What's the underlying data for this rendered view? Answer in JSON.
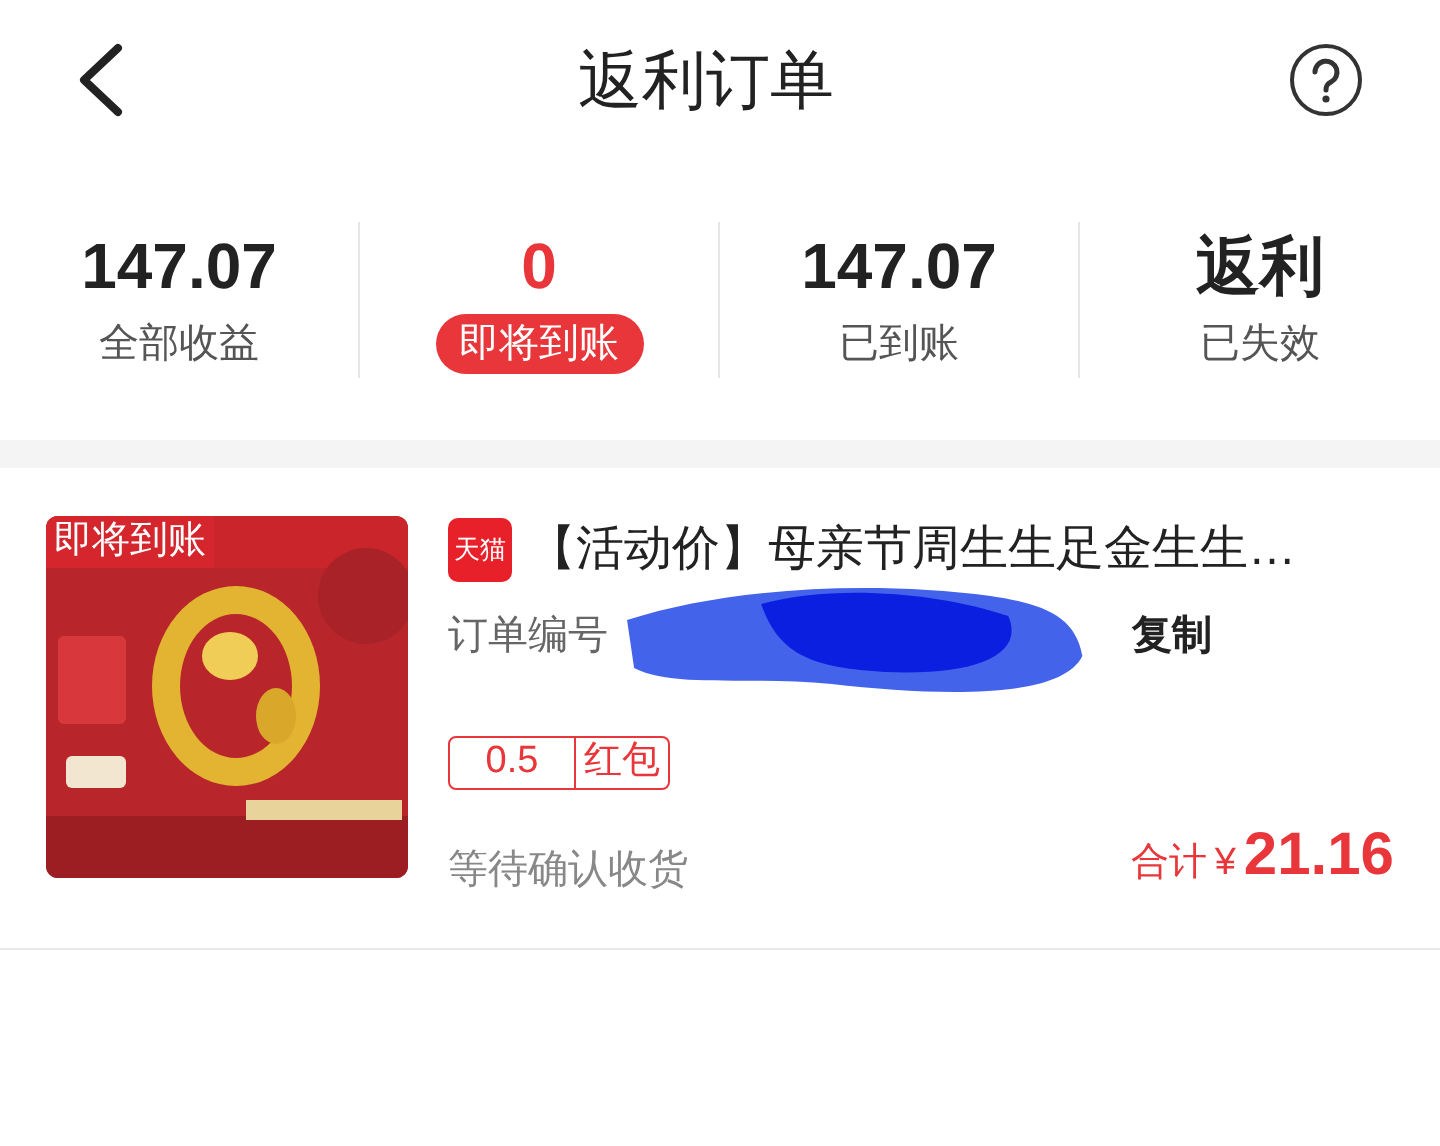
{
  "header": {
    "title": "返利订单"
  },
  "stats": [
    {
      "value": "147.07",
      "label": "全部收益",
      "selected": false
    },
    {
      "value": "0",
      "label": "即将到账",
      "selected": true
    },
    {
      "value": "147.07",
      "label": "已到账",
      "selected": false
    },
    {
      "value": "返利",
      "label": "已失效",
      "selected": false
    }
  ],
  "order": {
    "image": {
      "kind": "picture",
      "badge": "即将到账"
    },
    "shop_badge": "天猫",
    "title": "【活动价】母亲节周生生足金生生…",
    "order_number_label": "订单编号",
    "copy_button": "复制",
    "rebate_amount": "0.5",
    "rebate_type": "红包",
    "status": "等待确认收货",
    "total_label": "合计",
    "currency": "¥",
    "total": "21.16"
  }
}
